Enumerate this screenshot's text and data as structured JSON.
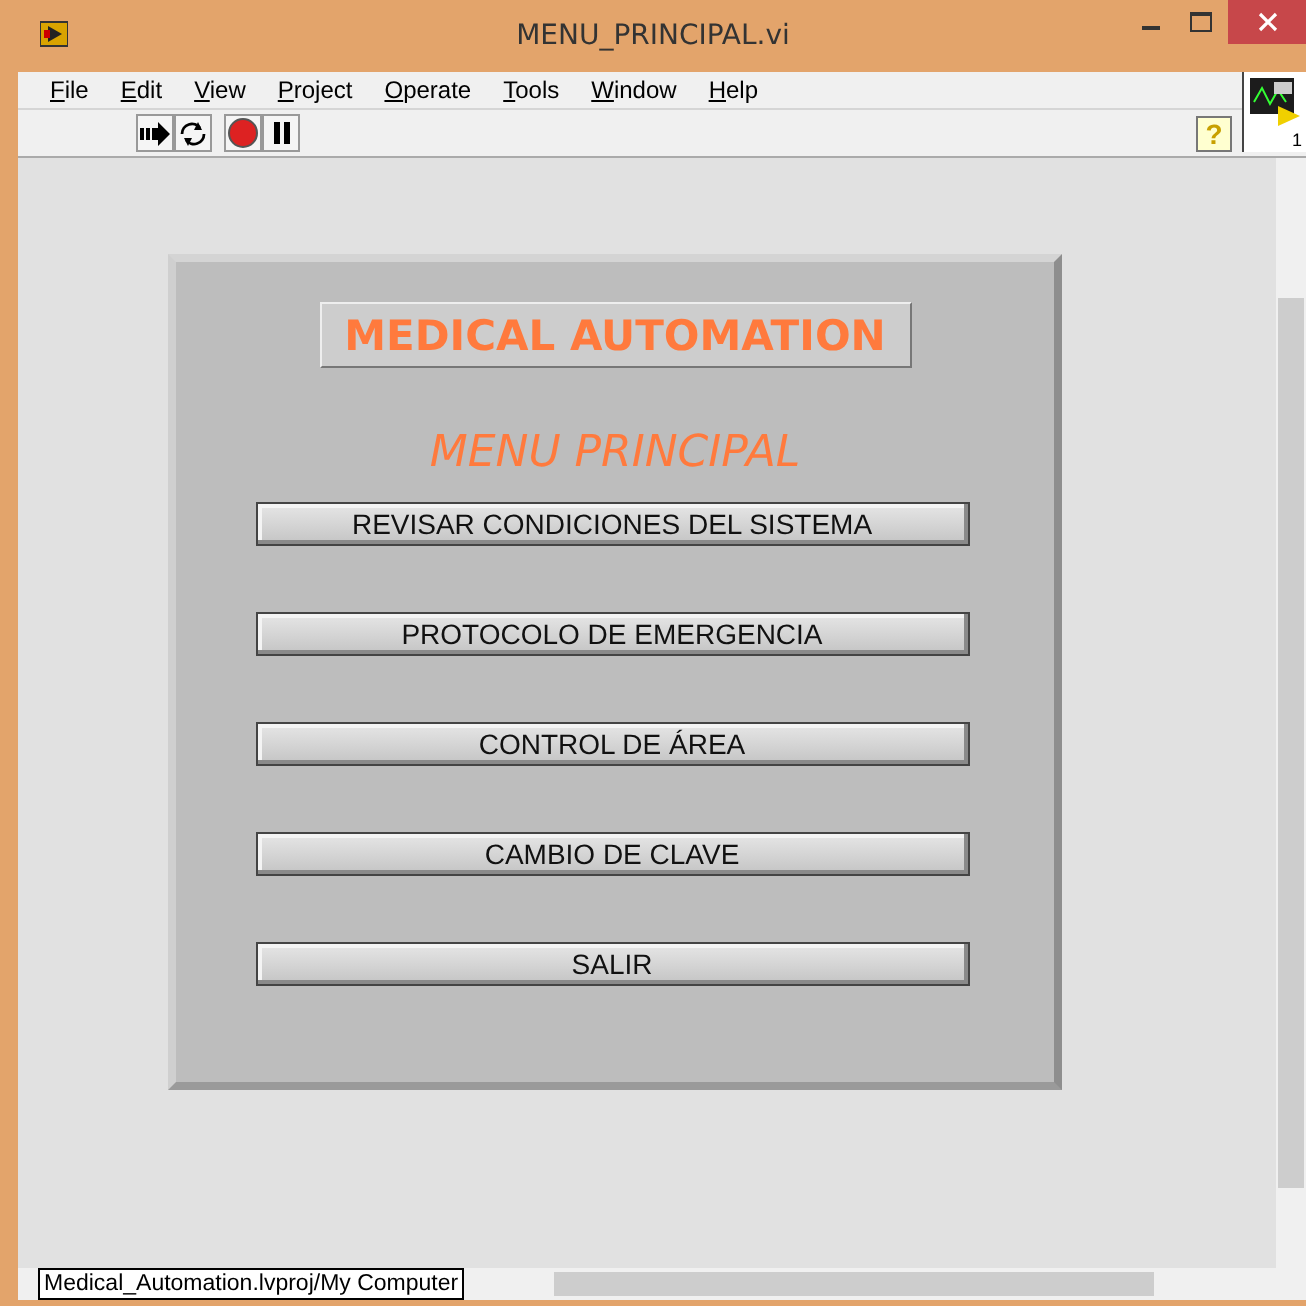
{
  "window": {
    "title": "MENU_PRINCIPAL.vi"
  },
  "menu": [
    "File",
    "Edit",
    "View",
    "Project",
    "Operate",
    "Tools",
    "Window",
    "Help"
  ],
  "help_button": "?",
  "panel": {
    "title": "MEDICAL AUTOMATION",
    "subtitle": "MENU PRINCIPAL",
    "buttons": [
      "REVISAR CONDICIONES DEL SISTEMA",
      "PROTOCOLO DE EMERGENCIA",
      "CONTROL DE ÁREA",
      "CAMBIO DE CLAVE",
      "SALIR"
    ]
  },
  "vi_icon_number": "1",
  "status_bar": {
    "context": "Medical_Automation.lvproj/My Computer"
  }
}
